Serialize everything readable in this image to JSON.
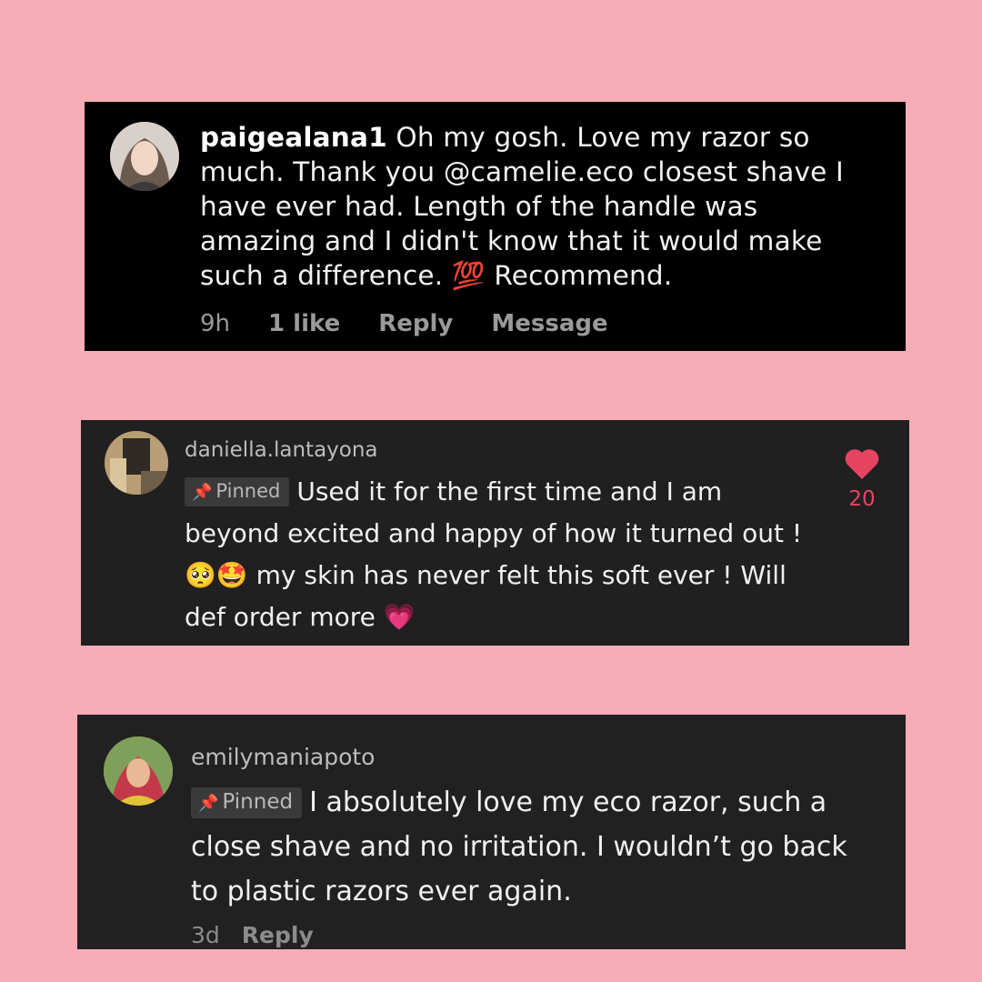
{
  "comments": [
    {
      "username": "paigealana1",
      "text": " Oh my gosh. Love my razor so much. Thank you @camelie.eco closest shave I have ever had. Length of the handle was amazing and I didn't know that it would make such a difference. 💯  Recommend.",
      "time": "9h",
      "likes": "1 like",
      "reply": "Reply",
      "message": "Message",
      "avatar_icon": "avatar-photo-icon"
    },
    {
      "username": "daniella.lantayona",
      "pinned_label": "Pinned",
      "text": "Used it for the first time and I am beyond excited and happy of how it turned out ! 🥺🤩 my skin has never felt this soft ever ! Will def order more 💗",
      "like_count": "20",
      "heart_color": "#e64561",
      "avatar_icon": "avatar-photo-icon"
    },
    {
      "username": "emilymaniapoto",
      "pinned_label": "Pinned",
      "text": "I absolutely love my eco razor, such a close shave and no irritation. I wouldn’t go back to plastic razors ever again.",
      "time": "3d",
      "reply": "Reply",
      "avatar_icon": "avatar-photo-icon"
    }
  ],
  "colors": {
    "background": "#f7adb6",
    "card1_bg": "#000000",
    "card_bg": "#202020"
  }
}
